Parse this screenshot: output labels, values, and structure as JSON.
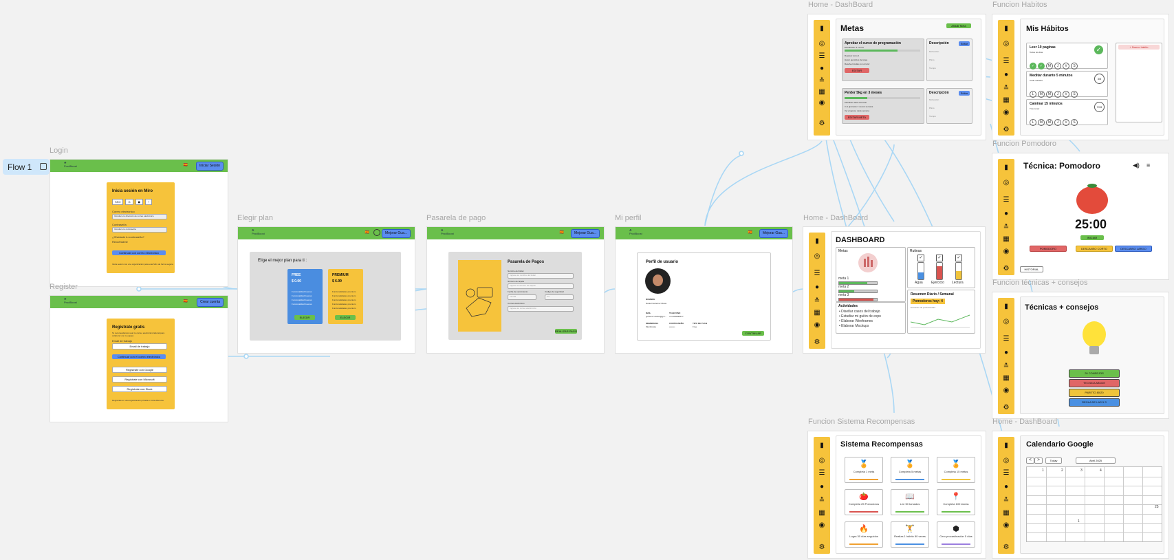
{
  "flow": {
    "label": "Flow 1"
  },
  "frame_titles": {
    "login": "Login",
    "register": "Register",
    "plan": "Elegir plan",
    "pay": "Pasarela de pago",
    "profile": "Mi perfil",
    "home_metas": "Home - DashBoard",
    "home_dash": "Home - DashBoard",
    "habitos": "Funcion Habitos",
    "pomodoro": "Funcion Pomodoro",
    "tecnicas": "Funcion técnicas + consejos",
    "recompensas": "Funcion Sistema Recompensas",
    "calendario": "Home - DashBoard"
  },
  "nav": {
    "flag": "🇪🇸",
    "login_btn": "Iniciar Sesión",
    "register_btn": "Crear cuenta",
    "upgrade_btn": "Mejorar Gua..."
  },
  "login": {
    "title": "Inicia sesión en Miro",
    "providers": [
      "SSO",
      "G",
      "◼",
      "+"
    ],
    "email_label": "Correo electrónico",
    "email_ph": "Introduce tu dirección de correo electrónico",
    "pass_label": "Contraseña",
    "pass_ph": "Introduce tu contraseña",
    "forgot": "¿Olvidaste tu contraseña?",
    "remember": "Recuérdame",
    "submit": "Continuar con correo electrónico",
    "footer": "Inicia sesión con una organización para usar Miro de forma segura"
  },
  "register": {
    "title": "Regístrate gratis",
    "subtitle": "Te recomendamos usar tu correo electrónico laboral para colaborar con tu equipo",
    "email_label": "Email de trabajo",
    "email_ph": "Email de trabajo",
    "submit": "Continuar con el correo electrónico",
    "google": "Regístrate con Google",
    "microsoft": "Regístrate con Microsoft",
    "slack": "Regístrate con Slack",
    "footer": "Regístrate en una organización privada o inicia diferente"
  },
  "plan": {
    "title": "Elige el mejor plan para ti :",
    "free": {
      "name": "FREE",
      "price": "$ 0.00",
      "features": [
        "Funcionalidad buenas",
        "Funcionalidad buenas",
        "Funcionalidad buenas",
        "Funcionalidad buenas"
      ],
      "cta": "ELEGIR"
    },
    "premium": {
      "name": "PREMIUM",
      "price": "$ 6.99",
      "features": [
        "Funcionalidades premium",
        "Funcionalidades premium",
        "Funcionalidades premium",
        "Funcionalidades premium",
        "Funcionalidades premium"
      ],
      "cta": "ELEGIR"
    }
  },
  "pay": {
    "title": "Pasarela de Pagos",
    "fields": [
      {
        "label": "Nombre del titular",
        "ph": "Ingrese su nombre del titular"
      },
      {
        "label": "Número de tarjeta",
        "ph": "Ingrese el número de tarjeta"
      },
      {
        "label": "Fecha de vencimiento",
        "ph": "mm/aa"
      },
      {
        "label": "Código de seguridad",
        "ph": "CV"
      },
      {
        "label": "Correo electrónico",
        "ph": "Ingrese su correo electrónico"
      }
    ],
    "submit": "REALIZAR PAGO"
  },
  "profile": {
    "title": "Perfil de usuario",
    "name_label": "NOMBRE",
    "name_value": "Daniel Gutierrez Rioas",
    "meta": [
      {
        "k": "MAIL",
        "v": "gutierrez.daniel@gm..."
      },
      {
        "k": "TELEFONO",
        "v": "+51 999999117"
      },
      {
        "k": "MEMBRESIA",
        "v": "Membresia"
      },
      {
        "k": "CONTRASEÑA",
        "v": "••••••••"
      },
      {
        "k": "TIPO DE PLAN",
        "v": "Free"
      }
    ],
    "continue": "CONTINUAR"
  },
  "metas": {
    "title": "Metas",
    "add_btn": "Añadir Meta",
    "goals": [
      {
        "title": "Aprobar el curso de programación",
        "sub": "Estudiando: 5 meses",
        "progress": 0.7,
        "color": "#5cb85c",
        "items": [
          "Repasar tema 1",
          "Hacer ejercicios de tarea",
          "Resolver dudas con el tutor"
        ],
        "btn": "EDITAR",
        "desc": "Descripción",
        "edit": "Editar",
        "rows": [
          "Motivación",
          "Plazo",
          "Tiempo"
        ]
      },
      {
        "title": "Perder 5kg en 3 meses",
        "sub": "",
        "progress": 0.3,
        "color": "#5cb85c",
        "items": [
          "Planificar dieta semanal",
          "Ir al gimnasio 3 veces/ semana",
          "Ver progreso cada semana"
        ],
        "btn": "EDITAR META",
        "desc": "Descripción",
        "edit": "Editar",
        "rows": [
          "Motivación",
          "Plazo",
          "Tiempo"
        ]
      }
    ]
  },
  "dash": {
    "title": "DASHBOARD",
    "metas_title": "Metas",
    "metas": [
      {
        "name": "meta 1",
        "value": 0.75,
        "color": "#5cb85c"
      },
      {
        "name": "meta 2",
        "value": 0.4,
        "color": "#5cb85c"
      },
      {
        "name": "meta 3",
        "value": 0.9,
        "color": "#d9534f"
      }
    ],
    "rutinas_title": "Rutinas",
    "rutinas": [
      {
        "name": "Agua",
        "value": 0.4,
        "color": "#4a90e2"
      },
      {
        "name": "Ejercicio",
        "value": 0.8,
        "color": "#d9534f"
      },
      {
        "name": "Lectura",
        "value": 0.5,
        "color": "#f0c43b"
      }
    ],
    "act_title": "Actividades",
    "activities": [
      "• Diseñar casos del trabajo",
      "• Estudiar mi guión de expo",
      "• Elaborar Wireframes",
      "• Elaborar Mockups"
    ],
    "resumen_title": "Resumen Diario / Semanal",
    "pomodoros": "Pomodoros hoy: 4",
    "chart_caption": "Evolución de productividad"
  },
  "habitos": {
    "title": "Mis Hábitos",
    "add": "+ Nuevo hábito",
    "habits": [
      {
        "name": "Leer 10 paginas",
        "sub": "Todos los días",
        "badge": "✓",
        "days": [
          "✓",
          "✓",
          "M",
          "J",
          "V",
          "S"
        ]
      },
      {
        "name": "Meditar durante 5 minutos",
        "sub": "Cada mañana",
        "badge": "3/5",
        "days": [
          "L",
          "M",
          "M",
          "J",
          "V",
          "S"
        ]
      },
      {
        "name": "Caminar 15 minutos",
        "sub": "Tras cenar",
        "badge": "7/15",
        "days": [
          "L",
          "M",
          "M",
          "J",
          "V",
          "S"
        ]
      }
    ]
  },
  "pomodoro": {
    "title": "Técnica: Pomodoro",
    "time": "25:00",
    "start": "INICIAR",
    "modes": [
      "POMODORO",
      "DESCANSO CORTO",
      "DESCANSO LARGO"
    ],
    "history": "HISTORIAL"
  },
  "tecnicas": {
    "title": "Técnicas + consejos",
    "items": [
      {
        "label": "20 CONSEJOS",
        "color": "#6abf4b"
      },
      {
        "label": "TECNICA ABCDE",
        "color": "#e06666"
      },
      {
        "label": "PARETO 80/20",
        "color": "#f0c43b"
      },
      {
        "label": "REGLA DE LAS 5 S",
        "color": "#4a90e2"
      }
    ]
  },
  "recompensas": {
    "title": "Sistema Recompensas",
    "items": [
      {
        "label": "Completa 1 meta",
        "icon": "🏅",
        "bar": "#f0a030"
      },
      {
        "label": "Completa 5 metas",
        "icon": "🏅",
        "bar": "#4a90e2"
      },
      {
        "label": "Completa 15 metas",
        "icon": "🏅",
        "bar": "#f0c43b"
      },
      {
        "label": "Completa 25 Pomodoros",
        "icon": "🍅",
        "bar": "#d9534f"
      },
      {
        "label": "Lee 50 tomados",
        "icon": "📖",
        "bar": "#6abf4b"
      },
      {
        "label": "Completa 100 tareas",
        "icon": "📍",
        "bar": "#6abf4b"
      },
      {
        "label": "Logra 30 días seguidos",
        "icon": "🔥",
        "bar": "#f0a030"
      },
      {
        "label": "Realiza 1 hábito 80 veces",
        "icon": "🏋",
        "bar": "#4a90e2"
      },
      {
        "label": "Cero procastinación 5 días",
        "icon": "⬢",
        "bar": "#9b7ede"
      }
    ]
  },
  "calendario": {
    "title": "Calendario Google",
    "nav_prev": "<",
    "nav_next": ">",
    "today": "Today",
    "month": "Abril 2025",
    "numbers": [
      "1",
      "2",
      "3",
      "4"
    ],
    "day_1": "1",
    "day_25": "25"
  }
}
